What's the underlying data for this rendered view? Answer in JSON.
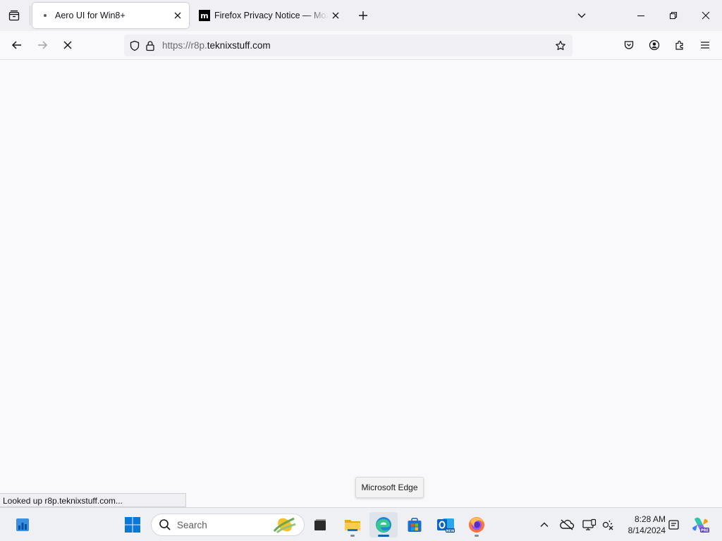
{
  "browser": {
    "tabs": [
      {
        "title": "Aero UI for Win8+",
        "favicon": "loading-dot-icon",
        "active": true
      },
      {
        "title": "Firefox Privacy Notice — Mozilla",
        "favicon": "mozilla-m-icon",
        "active": false
      }
    ],
    "url": {
      "prefix": "https://r8p.",
      "domain": "teknixstuff.com"
    },
    "status_text": "Looked up r8p.teknixstuff.com...",
    "page_loading": true
  },
  "taskbar": {
    "search_label": "Search",
    "tooltip": "Microsoft Edge",
    "clock": {
      "time": "8:28 AM",
      "date": "8/14/2024"
    },
    "pinned": [
      {
        "name": "widgets",
        "icon": "widgets-icon"
      },
      {
        "name": "start",
        "icon": "windows-start-icon"
      },
      {
        "name": "task-view",
        "icon": "task-view-icon"
      },
      {
        "name": "file-explorer",
        "icon": "folder-icon"
      },
      {
        "name": "edge",
        "icon": "edge-icon"
      },
      {
        "name": "store",
        "icon": "store-icon"
      },
      {
        "name": "outlook",
        "icon": "outlook-icon"
      },
      {
        "name": "firefox",
        "icon": "firefox-icon"
      }
    ],
    "tray": [
      "chevron-up-icon",
      "onedrive-offline-icon",
      "display-icon",
      "accessibility-icon",
      "notification-icon",
      "copilot-icon"
    ]
  },
  "colors": {
    "accent": "#0067c0",
    "tab_bg": "#f0f0f4",
    "content_bg": "#f9f9fb"
  }
}
